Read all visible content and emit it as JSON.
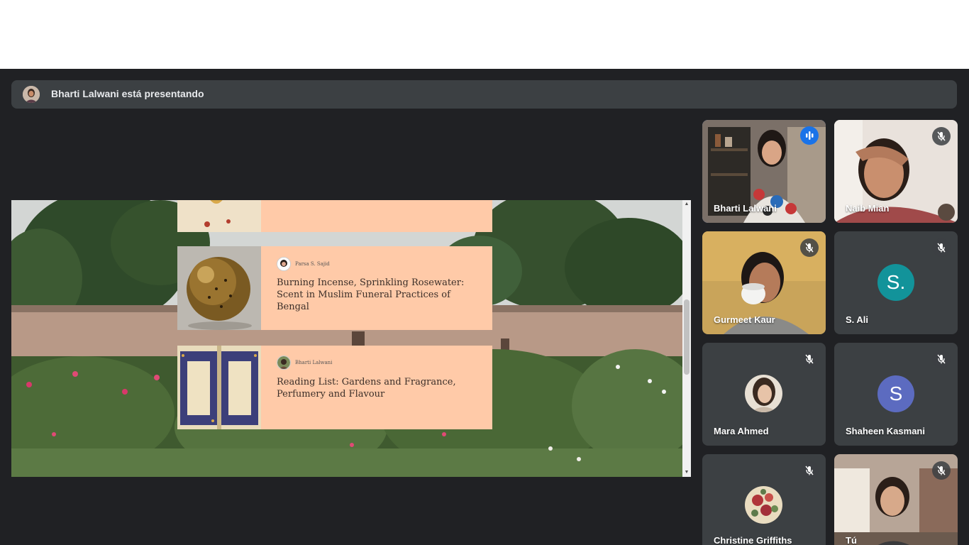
{
  "presenting": {
    "text": "Bharti Lalwani está presentando"
  },
  "presentation": {
    "cards": [
      {
        "author": "",
        "title": ""
      },
      {
        "author": "Parsa S. Sajid",
        "title": "Burning Incense, Sprinkling Rosewater: Scent in Muslim Funeral Practices of Bengal"
      },
      {
        "author": "Bharti Lalwani",
        "title": "Reading List: Gardens and Fragrance, Perfumery and Flavour"
      }
    ]
  },
  "participants": [
    {
      "name": "Bharti Lalwani",
      "state": "speaking",
      "avatar": "video"
    },
    {
      "name": "Naib Mian",
      "state": "muted",
      "avatar": "video"
    },
    {
      "name": "Gurmeet Kaur",
      "state": "muted",
      "avatar": "video"
    },
    {
      "name": "S. Ali",
      "state": "muted",
      "avatar": "S.",
      "avatar_color": "#12939a"
    },
    {
      "name": "Mara Ahmed",
      "state": "muted",
      "avatar": "photo"
    },
    {
      "name": "Shaheen Kasmani",
      "state": "muted",
      "avatar": "S",
      "avatar_color": "#5c6bc0"
    },
    {
      "name": "Christine Griffiths",
      "state": "muted",
      "avatar": "photo"
    },
    {
      "name": "Tú",
      "state": "muted",
      "avatar": "video"
    }
  ],
  "colors": {
    "background": "#202124",
    "tile": "#3c4043",
    "active_border": "#8ab4f8",
    "speaking": "#1a73e8",
    "card": "#ffcaa8"
  },
  "icons": {
    "muted": "mic-off-icon",
    "speaking": "audio-level-icon",
    "scroll_up": "scroll-up-arrow-icon",
    "scroll_down": "scroll-down-arrow-icon"
  }
}
